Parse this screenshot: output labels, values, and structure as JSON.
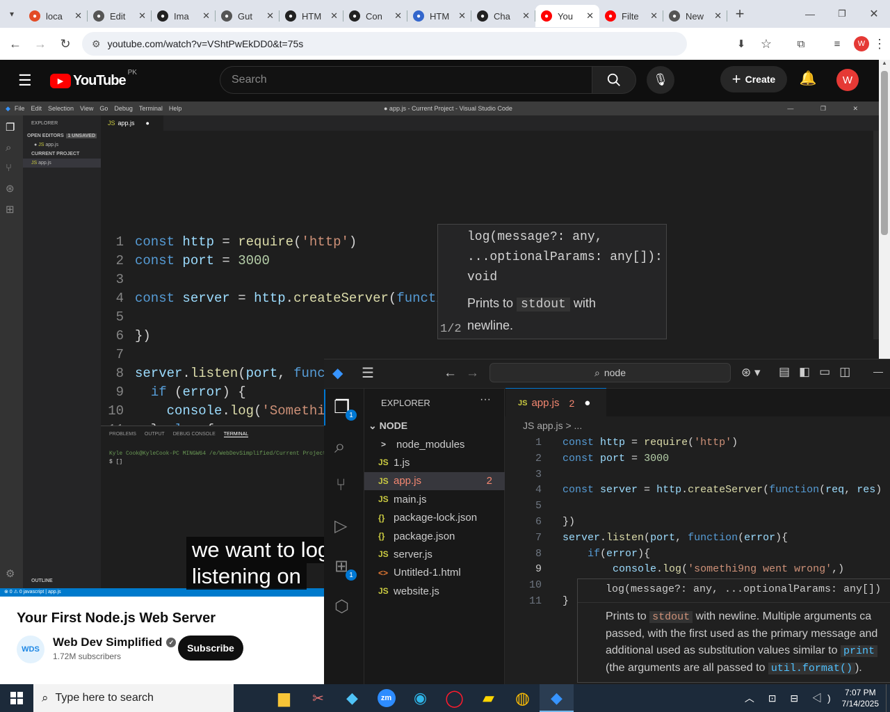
{
  "browser": {
    "tabs": [
      {
        "label": "loca",
        "color": "#e34c26"
      },
      {
        "label": "Edit",
        "color": "#555"
      },
      {
        "label": "Ima",
        "color": "#222"
      },
      {
        "label": "Gut",
        "color": "#555"
      },
      {
        "label": "HTM",
        "color": "#222"
      },
      {
        "label": "Con",
        "color": "#222"
      },
      {
        "label": "HTM",
        "color": "#3366cc"
      },
      {
        "label": "Cha",
        "color": "#222"
      },
      {
        "label": "You",
        "color": "#ff0000"
      },
      {
        "label": "Filte",
        "color": "#ff0000"
      },
      {
        "label": "New",
        "color": "#555"
      }
    ],
    "url": "youtube.com/watch?v=VShtPwEkDD0&t=75s",
    "profile": "W"
  },
  "youtube": {
    "logo_text": "YouTube",
    "region": "PK",
    "search_placeholder": "Search",
    "create_label": "Create",
    "avatar": "W",
    "video_title": "Your First Node.js Web Server",
    "channel_name": "Web Dev Simplified",
    "channel_logo": "WDS",
    "subscribers": "1.72M subscribers",
    "subscribe_label": "Subscribe",
    "caption_line1": "we want to log",
    "caption_line2": "listening on"
  },
  "outer_editor": {
    "menu": [
      "File",
      "Edit",
      "Selection",
      "View",
      "Go",
      "Debug",
      "Terminal",
      "Help"
    ],
    "window_title": "● app.js - Current Project - Visual Studio Code",
    "tab": "app.js",
    "explorer_title": "EXPLORER",
    "open_editors": "OPEN EDITORS",
    "unsaved": "1 UNSAVED",
    "open_file": "app.js",
    "project": "CURRENT PROJECT",
    "project_file": "app.js",
    "outline": "OUTLINE",
    "panel_tabs": [
      "PROBLEMS",
      "OUTPUT",
      "DEBUG CONSOLE",
      "TERMINAL"
    ],
    "terminal_prompt": "Kyle Cook@KyleCook-PC MINGW64 /e/WebDevSimplified/Current Project",
    "terminal_line2": "$ []",
    "status": "⊗ 0 ⚠ 0   javascript | app.js",
    "hover_sig1": "log(message?: any,",
    "hover_sig2": "...optionalParams: any[]):",
    "hover_sig3": "void",
    "hover_doc1": "Prints to",
    "hover_code": "stdout",
    "hover_doc2": "with",
    "hover_doc3": "newline.",
    "hover_page": "1/2"
  },
  "inner_editor": {
    "search": "node",
    "explorer_title": "EXPLORER",
    "folder": "NODE",
    "files": [
      {
        "icon": ">",
        "name": "node_modules"
      },
      {
        "icon": "JS",
        "name": "1.js"
      },
      {
        "icon": "JS",
        "name": "app.js",
        "badge": "2"
      },
      {
        "icon": "JS",
        "name": "main.js"
      },
      {
        "icon": "{}",
        "name": "package-lock.json"
      },
      {
        "icon": "{}",
        "name": "package.json"
      },
      {
        "icon": "JS",
        "name": "server.js"
      },
      {
        "icon": "<>",
        "name": "Untitled-1.html"
      },
      {
        "icon": "JS",
        "name": "website.js"
      }
    ],
    "tab": "app.js",
    "tab_badge": "2",
    "breadcrumb": "JS app.js > ...",
    "hover_sig": "log(message?: any, ...optionalParams: any[])",
    "hover_doc1": "Prints to",
    "hover_code1": "stdout",
    "hover_doc2": "with newline. Multiple arguments ca",
    "hover_doc3": "passed, with the first used as the primary message and",
    "hover_doc4": "additional used as substitution values similar to",
    "hover_code2": "print",
    "hover_doc5": "(the arguments are all passed to",
    "hover_code3": "util.format()",
    "hover_doc6": ")."
  },
  "taskbar": {
    "search_placeholder": "Type here to search",
    "time": "7:07 PM",
    "date": "7/14/2025"
  }
}
